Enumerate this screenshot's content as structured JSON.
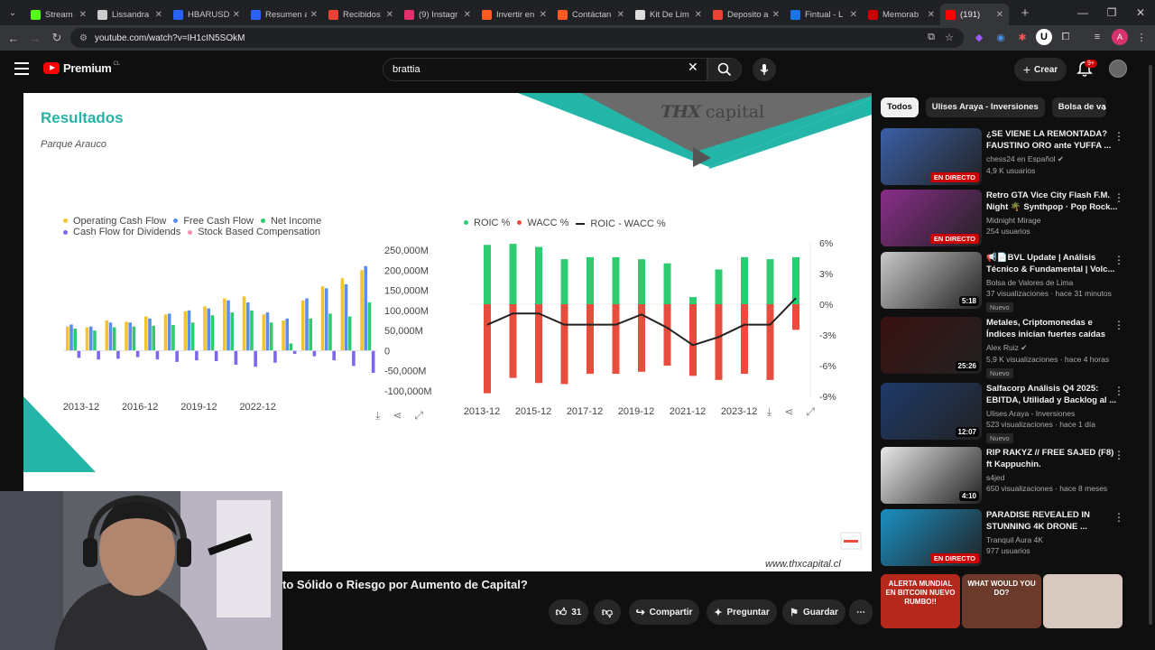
{
  "browser": {
    "tabs": [
      {
        "title": "Stream - K",
        "color": "#53fc18"
      },
      {
        "title": "Lissandra",
        "color": "#cccccc"
      },
      {
        "title": "HBARUSD",
        "color": "#2962ff"
      },
      {
        "title": "Resumen a",
        "color": "#2962ff"
      },
      {
        "title": "Recibidos",
        "color": "#ea4335"
      },
      {
        "title": "(9) Instagr",
        "color": "#e1306c"
      },
      {
        "title": "Invertir en",
        "color": "#ff5a1f"
      },
      {
        "title": "Contáctan",
        "color": "#ff5a1f"
      },
      {
        "title": "Kit De Lim",
        "color": "#dddddd"
      },
      {
        "title": "Deposito a",
        "color": "#ea4335"
      },
      {
        "title": "Fintual - L",
        "color": "#1a73e8"
      },
      {
        "title": "Memorab",
        "color": "#cc0000"
      },
      {
        "title": "(191)",
        "color": "#ff0000"
      }
    ],
    "url": "youtube.com/watch?v=IH1cIN5SOkM"
  },
  "header": {
    "logo_text": "Premium",
    "logo_sup": "CL",
    "search_value": "brattia",
    "create_label": "Crear",
    "notif_badge": "9+"
  },
  "slide": {
    "title": "Resultados",
    "subtitle": "Parque Arauco",
    "brand_thx": "THX",
    "brand_capital": "capital",
    "footer_url": "www.thxcapital.cl"
  },
  "chart_data": [
    {
      "type": "bar",
      "legend": [
        "Operating Cash Flow",
        "Free Cash Flow",
        "Net Income",
        "Cash Flow for Dividends",
        "Stock Based Compensation"
      ],
      "colors": [
        "#f4c430",
        "#5b8def",
        "#2ecc71",
        "#7b68ee",
        "#f48fb1"
      ],
      "x_tick_labels": [
        "2013-12",
        "2016-12",
        "2019-12",
        "2022-12"
      ],
      "y_tick_labels": [
        "250,000M",
        "200,000M",
        "150,000M",
        "100,000M",
        "50,000M",
        "0",
        "-50,000M",
        "-100,000M"
      ],
      "ylim": [
        -100000,
        250000
      ],
      "groups": [
        {
          "values": [
            60000,
            65000,
            55000,
            -18000
          ]
        },
        {
          "values": [
            58000,
            60000,
            50000,
            -22000
          ]
        },
        {
          "values": [
            75000,
            70000,
            58000,
            -20000
          ]
        },
        {
          "values": [
            72000,
            70000,
            60000,
            -16000
          ]
        },
        {
          "values": [
            85000,
            80000,
            62000,
            -22000
          ]
        },
        {
          "values": [
            90000,
            92000,
            64000,
            -28000
          ]
        },
        {
          "values": [
            98000,
            100000,
            70000,
            -24000
          ]
        },
        {
          "values": [
            110000,
            105000,
            88000,
            -26000
          ]
        },
        {
          "values": [
            130000,
            125000,
            95000,
            -35000
          ]
        },
        {
          "values": [
            135000,
            120000,
            100000,
            -40000
          ]
        },
        {
          "values": [
            90000,
            95000,
            70000,
            -30000
          ]
        },
        {
          "values": [
            75000,
            80000,
            18000,
            -8000
          ]
        },
        {
          "values": [
            125000,
            130000,
            80000,
            -14000
          ]
        },
        {
          "values": [
            160000,
            155000,
            92000,
            -24000
          ]
        },
        {
          "values": [
            180000,
            165000,
            85000,
            -38000
          ]
        },
        {
          "values": [
            200000,
            210000,
            120000,
            -55000
          ]
        }
      ]
    },
    {
      "type": "bar",
      "legend": [
        "ROIC %",
        "WACC %",
        "ROIC - WACC %"
      ],
      "colors": [
        "#2ecc71",
        "#e74c3c",
        "#222222"
      ],
      "x_tick_labels": [
        "2013-12",
        "2015-12",
        "2017-12",
        "2019-12",
        "2021-12",
        "2023-12"
      ],
      "y_tick_labels": [
        "6%",
        "3%",
        "0%",
        "-3%",
        "-6%",
        "-9%"
      ],
      "ylim": [
        -9,
        6
      ],
      "roic": [
        5.8,
        5.9,
        5.6,
        4.4,
        4.6,
        4.6,
        4.4,
        4.0,
        0.7,
        3.4,
        4.6,
        4.4,
        4.6
      ],
      "wacc": [
        -8.7,
        -7.2,
        -7.7,
        -7.8,
        -6.8,
        -6.8,
        -6.6,
        -6.0,
        -7.0,
        -7.4,
        -6.8,
        -7.4,
        -2.5
      ],
      "spread": [
        -2.0,
        -0.9,
        -0.9,
        -2.0,
        -2.0,
        -2.0,
        -1.0,
        -2.3,
        -4.0,
        -3.2,
        -2.0,
        -2.0,
        0.6
      ]
    }
  ],
  "video": {
    "title_fragment": "to Sólido o Riesgo por Aumento de Capital?",
    "likes": "31",
    "share_label": "Compartir",
    "ask_label": "Preguntar",
    "save_label": "Guardar"
  },
  "sidebar": {
    "chips": [
      "Todos",
      "Ulises Araya - Inversiones",
      "Bolsa de va"
    ],
    "recs": [
      {
        "title": "¿SE VIENE LA REMONTADA? FAUSTINO ORO ante YUFFA ...",
        "channel": "chess24 en Español",
        "verified": true,
        "views": "4,9 K usuarios",
        "badge_live": "EN DIRECTO",
        "nuevo": "",
        "duration": "",
        "thumb": "#3b5fa8"
      },
      {
        "title": "Retro GTA Vice City Flash F.M. Night 🌴 Synthpop · Pop Rock...",
        "channel": "Midnight Mirage",
        "verified": false,
        "views": "254 usuarios",
        "badge_live": "EN DIRECTO",
        "nuevo": "",
        "duration": "",
        "thumb": "#8a2d8a"
      },
      {
        "title": "📢📄BVL Update | Análisis Técnico & Fundamental | Volc...",
        "channel": "Bolsa de Valores de Lima",
        "verified": false,
        "views": "37 visualizaciones · hace 31 minutos",
        "badge_live": "",
        "nuevo": "Nuevo",
        "duration": "5:18",
        "thumb": "#c9c9c9"
      },
      {
        "title": "Metales, Criptomonedas e Índices inician fuertes caídas",
        "channel": "Alex Ruiz",
        "verified": true,
        "views": "5,9 K visualizaciones · hace 4 horas",
        "badge_live": "",
        "nuevo": "Nuevo",
        "duration": "25:26",
        "thumb": "#3a1010"
      },
      {
        "title": "Salfacorp Análisis Q4 2025: EBITDA, Utilidad y Backlog al ...",
        "channel": "Ulises Araya - Inversiones",
        "verified": false,
        "views": "523 visualizaciones · hace 1 día",
        "badge_live": "",
        "nuevo": "Nuevo",
        "duration": "12:07",
        "thumb": "#1e3a6a"
      },
      {
        "title": "RIP RAKYZ // FREE SAJED (F8) ft Kappuchin.",
        "channel": "s4jed",
        "verified": false,
        "views": "650 visualizaciones · hace 8 meses",
        "badge_live": "",
        "nuevo": "",
        "duration": "4:10",
        "thumb": "#e8e8e8"
      },
      {
        "title": "PARADISE REVEALED IN STUNNING 4K DRONE ...",
        "channel": "Tranquil Aura 4K",
        "verified": false,
        "views": "977 usuarios",
        "badge_live": "EN DIRECTO",
        "nuevo": "",
        "duration": "",
        "thumb": "#1a8fc2"
      }
    ],
    "shorts": [
      {
        "text": "ALERTA MUNDIAL EN BITCOIN NUEVO RUMBO!!",
        "color": "#b5281c"
      },
      {
        "text": "WHAT WOULD YOU DO?",
        "color": "#6b3a2a"
      },
      {
        "text": "",
        "color": "#d8c9c0"
      }
    ]
  }
}
